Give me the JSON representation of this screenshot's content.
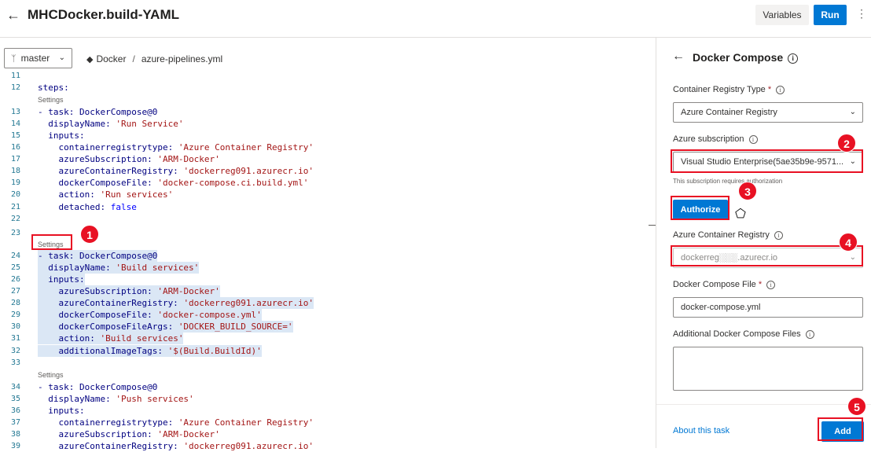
{
  "header": {
    "title": "MHCDocker.build-YAML",
    "variables_label": "Variables",
    "run_label": "Run"
  },
  "toolbar": {
    "branch": "master",
    "breadcrumb": [
      "Docker",
      "azure-pipelines.yml"
    ]
  },
  "editor": {
    "settings_label": "Settings",
    "lines": {
      "l11": {
        "n": "11"
      },
      "l12": {
        "n": "12",
        "t": "steps:"
      },
      "l13": {
        "n": "13",
        "t": "- task: DockerCompose@0"
      },
      "l14": {
        "n": "14",
        "a": "  displayName: ",
        "b": "'Run Service'"
      },
      "l15": {
        "n": "15",
        "t": "  inputs:"
      },
      "l16": {
        "n": "16",
        "a": "    containerregistrytype: ",
        "b": "'Azure Container Registry'"
      },
      "l17": {
        "n": "17",
        "a": "    azureSubscription: ",
        "b": "'ARM-Docker'"
      },
      "l18": {
        "n": "18",
        "a": "    azureContainerRegistry: ",
        "b": "'dockerreg091.azurecr.io'"
      },
      "l19": {
        "n": "19",
        "a": "    dockerComposeFile: ",
        "b": "'docker-compose.ci.build.yml'"
      },
      "l20": {
        "n": "20",
        "a": "    action: ",
        "b": "'Run services'"
      },
      "l21": {
        "n": "21",
        "a": "    detached: ",
        "b": "false"
      },
      "l22": {
        "n": "22"
      },
      "l23": {
        "n": "23"
      },
      "l24": {
        "n": "24",
        "t": "- task: DockerCompose@0"
      },
      "l25": {
        "n": "25",
        "a": "  displayName: ",
        "b": "'Build services'"
      },
      "l26": {
        "n": "26",
        "t": "  inputs:"
      },
      "l27": {
        "n": "27",
        "a": "    azureSubscription: ",
        "b": "'ARM-Docker'"
      },
      "l28": {
        "n": "28",
        "a": "    azureContainerRegistry: ",
        "b": "'dockerreg091.azurecr.io'"
      },
      "l29": {
        "n": "29",
        "a": "    dockerComposeFile: ",
        "b": "'docker-compose.yml'"
      },
      "l30": {
        "n": "30",
        "a": "    dockerComposeFileArgs: ",
        "b": "'DOCKER_BUILD_SOURCE='"
      },
      "l31": {
        "n": "31",
        "a": "    action: ",
        "b": "'Build services'"
      },
      "l32": {
        "n": "32",
        "a": "    additionalImageTags: ",
        "b": "'$(Build.BuildId)'"
      },
      "l33": {
        "n": "33"
      },
      "l34": {
        "n": "34",
        "t": "- task: DockerCompose@0"
      },
      "l35": {
        "n": "35",
        "a": "  displayName: ",
        "b": "'Push services'"
      },
      "l36": {
        "n": "36",
        "t": "  inputs:"
      },
      "l37": {
        "n": "37",
        "a": "    containerregistrytype: ",
        "b": "'Azure Container Registry'"
      },
      "l38": {
        "n": "38",
        "a": "    azureSubscription: ",
        "b": "'ARM-Docker'"
      },
      "l39": {
        "n": "39",
        "a": "    azureContainerRegistry: ",
        "b": "'dockerreg091.azurecr.io'"
      }
    }
  },
  "panel": {
    "title": "Docker Compose",
    "registry_type_label": "Container Registry Type",
    "registry_type_value": "Azure Container Registry",
    "subscription_label": "Azure subscription",
    "subscription_value": "Visual Studio Enterprise(5ae35b9e-9571...",
    "subscription_hint": "This subscription requires authorization",
    "authorize_label": "Authorize",
    "acr_label": "Azure Container Registry",
    "acr_value": "dockerreg░░░.azurecr.io",
    "compose_file_label": "Docker Compose File",
    "compose_file_value": "docker-compose.yml",
    "additional_label": "Additional Docker Compose Files",
    "about_label": "About this task",
    "add_label": "Add"
  },
  "annotations": [
    "1",
    "2",
    "3",
    "4",
    "5"
  ],
  "colors": {
    "accent": "#0078d4",
    "annotation": "#e81123"
  }
}
